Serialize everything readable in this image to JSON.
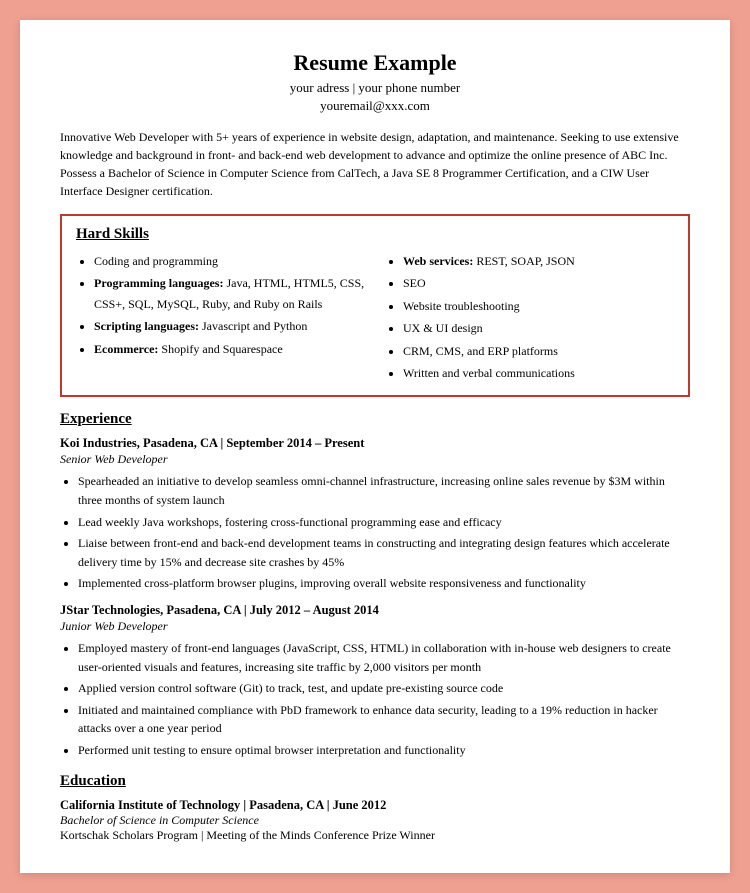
{
  "resume": {
    "title": "Resume Example",
    "contact": {
      "line1": "your adress | your phone number",
      "email": "youremail@xxx.com"
    },
    "summary": "Innovative Web Developer with 5+ years of experience in website design, adaptation, and maintenance. Seeking to use extensive knowledge and background in front- and back-end web development to advance and optimize the online presence of ABC Inc. Possess a Bachelor of Science in Computer Science from CalTech, a Java SE 8 Programmer Certification, and a CIW User Interface Designer certification.",
    "hard_skills": {
      "title": "Hard Skills",
      "left_col": [
        {
          "text": "Coding and programming",
          "bold_prefix": ""
        },
        {
          "text": "Java, HTML, HTML5, CSS, CSS+, SQL, MySQL, Ruby, and Ruby on Rails",
          "bold_prefix": "Programming languages:"
        },
        {
          "text": "Javascript and Python",
          "bold_prefix": "Scripting languages:"
        },
        {
          "text": "Shopify and Squarespace",
          "bold_prefix": "Ecommerce:"
        }
      ],
      "right_col": [
        {
          "text": "REST, SOAP, JSON",
          "bold_prefix": "Web services:"
        },
        {
          "text": "SEO",
          "bold_prefix": ""
        },
        {
          "text": "Website troubleshooting",
          "bold_prefix": ""
        },
        {
          "text": "UX & UI design",
          "bold_prefix": ""
        },
        {
          "text": "CRM, CMS, and ERP platforms",
          "bold_prefix": ""
        },
        {
          "text": "Written and verbal communications",
          "bold_prefix": ""
        }
      ]
    },
    "experience": {
      "title": "Experience",
      "jobs": [
        {
          "company": "Koi Industries, Pasadena, CA | September 2014 – Present",
          "title": "Senior Web Developer",
          "bullets": [
            "Spearheaded an initiative to develop seamless omni-channel infrastructure, increasing online sales revenue by $3M within three months of system launch",
            "Lead weekly Java workshops, fostering cross-functional programming ease and efficacy",
            "Liaise between front-end and back-end development teams in constructing and integrating design features which accelerate delivery time by 15% and decrease site crashes by 45%",
            "Implemented cross-platform browser plugins, improving overall website responsiveness and functionality"
          ]
        },
        {
          "company": "JStar Technologies, Pasadena, CA | July 2012 – August 2014",
          "title": "Junior Web Developer",
          "bullets": [
            "Employed mastery of front-end languages (JavaScript, CSS, HTML) in collaboration with in-house web designers to create user-oriented visuals and features, increasing site traffic by 2,000 visitors per month",
            "Applied version control software (Git) to track, test, and update pre-existing source code",
            "Initiated and maintained compliance with PbD framework to enhance data security, leading to a 19% reduction in hacker attacks over a one year period",
            "Performed unit testing to ensure optimal browser interpretation and functionality"
          ]
        }
      ]
    },
    "education": {
      "title": "Education",
      "school": "California Institute of Technology",
      "location_date": "Pasadena, CA | June 2012",
      "degree": "Bachelor of Science in Computer Science",
      "award": "Kortschak Scholars Program | Meeting of the Minds Conference Prize Winner"
    }
  }
}
